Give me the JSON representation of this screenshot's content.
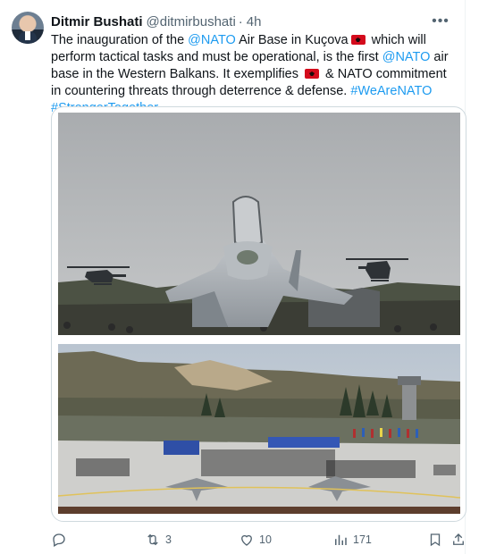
{
  "author": {
    "name": "Ditmir Bushati",
    "handle": "@ditmirbushati",
    "separator": "·",
    "time": "4h"
  },
  "tweet": {
    "line1_a": "The inauguration of the ",
    "mention_nato": "@NATO",
    "line1_b": " Air Base in Kuçova",
    "line1_c": " which will perform tactical tasks and must be operational, is the first ",
    "line2_b": " air base in the Western Balkans. It exemplifies ",
    "line3_b": " & NATO commitment in countering threats through deterrence & defense. ",
    "hashtag1": "#WeAreNATO",
    "hashtag2": "#StrongerTogether"
  },
  "icons": {
    "flag": "albania-flag-icon",
    "more": "more-options-icon",
    "reply": "reply-icon",
    "retweet": "retweet-icon",
    "like": "like-icon",
    "views": "views-icon",
    "bookmark": "bookmark-icon",
    "share": "share-icon"
  },
  "colors": {
    "link": "#1d9bf0",
    "secondary_text": "#536471",
    "primary_text": "#0f1419",
    "flag_red": "#d40b1c"
  },
  "actions": {
    "reply_count": "",
    "retweet_count": "3",
    "like_count": "10",
    "views_count": "171"
  }
}
